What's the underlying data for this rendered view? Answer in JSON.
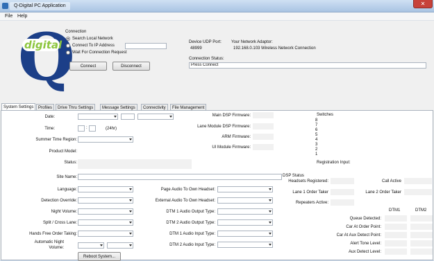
{
  "window": {
    "title": "Q-Digital PC Application",
    "close_glyph": "✕"
  },
  "menu": {
    "items": [
      "File",
      "Help"
    ]
  },
  "logo": {
    "letter": "Q",
    "word": "digital"
  },
  "connection": {
    "heading": "Connection",
    "options": [
      "Search Local Network",
      "Connect To IP Address",
      "Wait For Connection Request"
    ],
    "selected_index": 0,
    "connect_label": "Connect",
    "disconnect_label": "Disconnect",
    "device_udp_port_label": "Device UDP Port:",
    "device_udp_port_value": "48999",
    "network_adaptor_label": "Your Network Adaptor:",
    "network_adaptor_value": "192.168.0.103 Wireless Network Connection",
    "status_label": "Connection Status:",
    "status_value": "Press Connect"
  },
  "tabs": [
    "System Settings",
    "Profiles",
    "Drive Thru Settings",
    "Message Settings",
    "Connectivity",
    "File Management"
  ],
  "active_tab": 0,
  "system": {
    "date_label": "Date:",
    "time_label": "Time:",
    "time_sep": ":",
    "time_format": "(24hr)",
    "summer_time_label": "Summer Time Region:",
    "product_model_label": "Product Model:",
    "status_label": "Status:",
    "main_dsp_label": "Main DSP Firmware:",
    "lane_dsp_label": "Lane Module DSP Firmware:",
    "arm_label": "ARM Firmware:",
    "ui_label": "UI Module Firmware:",
    "switches_label": "Switches",
    "switch_numbers": [
      "8",
      "7",
      "6",
      "5",
      "4",
      "3",
      "2",
      "1"
    ],
    "registration_label": "Registration Input:",
    "site_name_label": "Site Name:",
    "language_label": "Language:",
    "detection_override_label": "Detection Override:",
    "night_volume_label": "Night Volume:",
    "split_cross_label": "Split / Cross Lane:",
    "hands_free_label": "Hands Free Order Taking:",
    "auto_night_label": "Automatic Night Volume:",
    "reboot_label": "Reboot System...",
    "page_audio_label": "Page Audio To Own Headset:",
    "external_audio_label": "External Audio To Own Headset:",
    "dtm1_out_label": "DTM 1 Audio Output Type:",
    "dtm2_out_label": "DTM 2 Audio Output Type:",
    "dtm1_in_label": "DTM 1 Audio Input Type:",
    "dtm2_in_label": "DTM 2 Audio Input Type:"
  },
  "dsp": {
    "status_label": "DSP Status",
    "headsets_label": "Headsets Registered:",
    "call_active_label": "Call Active",
    "lane1_label": "Lane 1 Order Taker",
    "lane2_label": "Lane 2 Order Taker",
    "repeaters_label": "Repeaters Active:",
    "dtm1_col": "DTM1",
    "dtm2_col": "DTM2",
    "queue_label": "Queue Detected:",
    "car_order_label": "Car At Order Point:",
    "car_aux_label": "Car At Aux Detect Point:",
    "alert_tone_label": "Alert Tone Level:",
    "aux_detect_label": "Aux Detect Level:"
  }
}
